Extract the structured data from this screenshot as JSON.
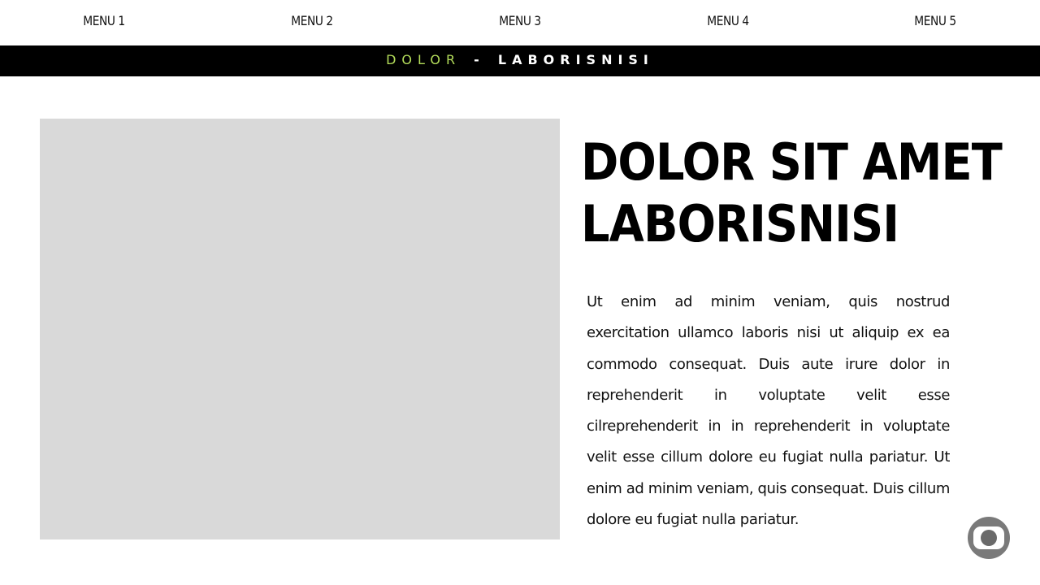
{
  "nav": {
    "items": [
      {
        "label": "MENU 1"
      },
      {
        "label": "MENU 2"
      },
      {
        "label": "MENU 3"
      },
      {
        "label": "MENU 4"
      },
      {
        "label": "MENU 5"
      }
    ]
  },
  "banner": {
    "accent_text": "DOLOR",
    "separator": "-",
    "main_text": "LABORISNISI",
    "accent_color": "#b3dc5a"
  },
  "main": {
    "heading_line1": "DOLOR SIT AMET",
    "heading_line2": "LABORISNISI",
    "body": "Ut enim ad minim veniam, quis nostrud exercitation ullamco laboris nisi ut aliquip ex ea commodo consequat. Duis aute irure dolor in reprehenderit in voluptate velit esse cilreprehenderit in in reprehenderit in voluptate velit esse cillum dolore eu fugiat nulla pariatur. Ut enim ad minim veniam, quis consequat. Duis cillum dolore eu fugiat nulla pariatur.",
    "image_placeholder_color": "#d9d9d9"
  },
  "floating_button": {
    "icon": "camera-icon"
  }
}
